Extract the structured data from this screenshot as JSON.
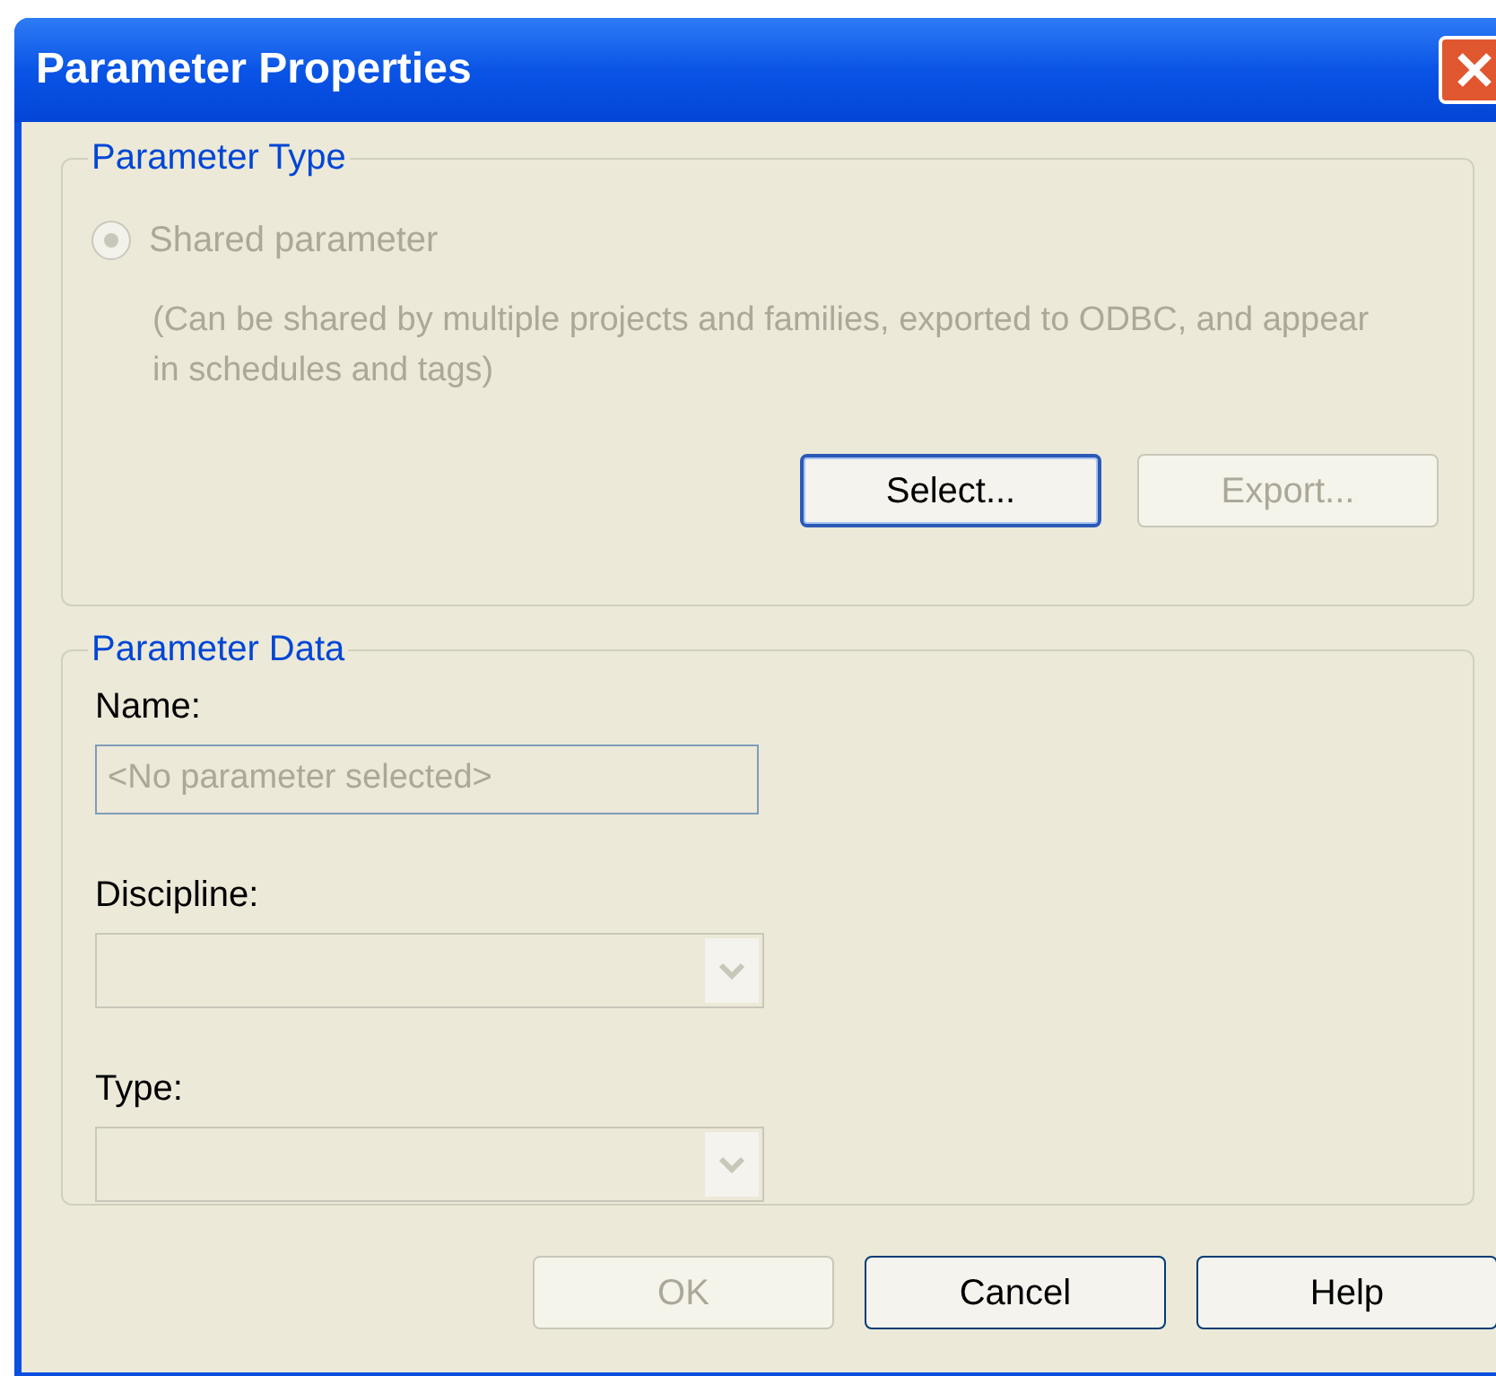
{
  "window": {
    "title": "Parameter Properties"
  },
  "parameter_type": {
    "title": "Parameter Type",
    "radio": {
      "label": "Shared parameter",
      "selected": true,
      "disabled": true
    },
    "description": "(Can be shared by multiple projects and families, exported to ODBC, and appear in schedules and tags)",
    "buttons": [
      {
        "label": "Select...",
        "disabled": false,
        "focused": true
      },
      {
        "label": "Export...",
        "disabled": true,
        "focused": false
      }
    ]
  },
  "parameter_data": {
    "title": "Parameter Data",
    "fields": [
      {
        "kind": "text",
        "label": "Name:",
        "value": "<No parameter selected>",
        "disabled": true
      },
      {
        "kind": "combo",
        "label": "Discipline:",
        "disabled": true
      },
      {
        "kind": "combo",
        "label": "Type:",
        "disabled": true
      }
    ]
  },
  "buttons": [
    {
      "label": "OK",
      "disabled": true
    },
    {
      "label": "Cancel",
      "disabled": false
    },
    {
      "label": "Help",
      "disabled": false
    }
  ]
}
